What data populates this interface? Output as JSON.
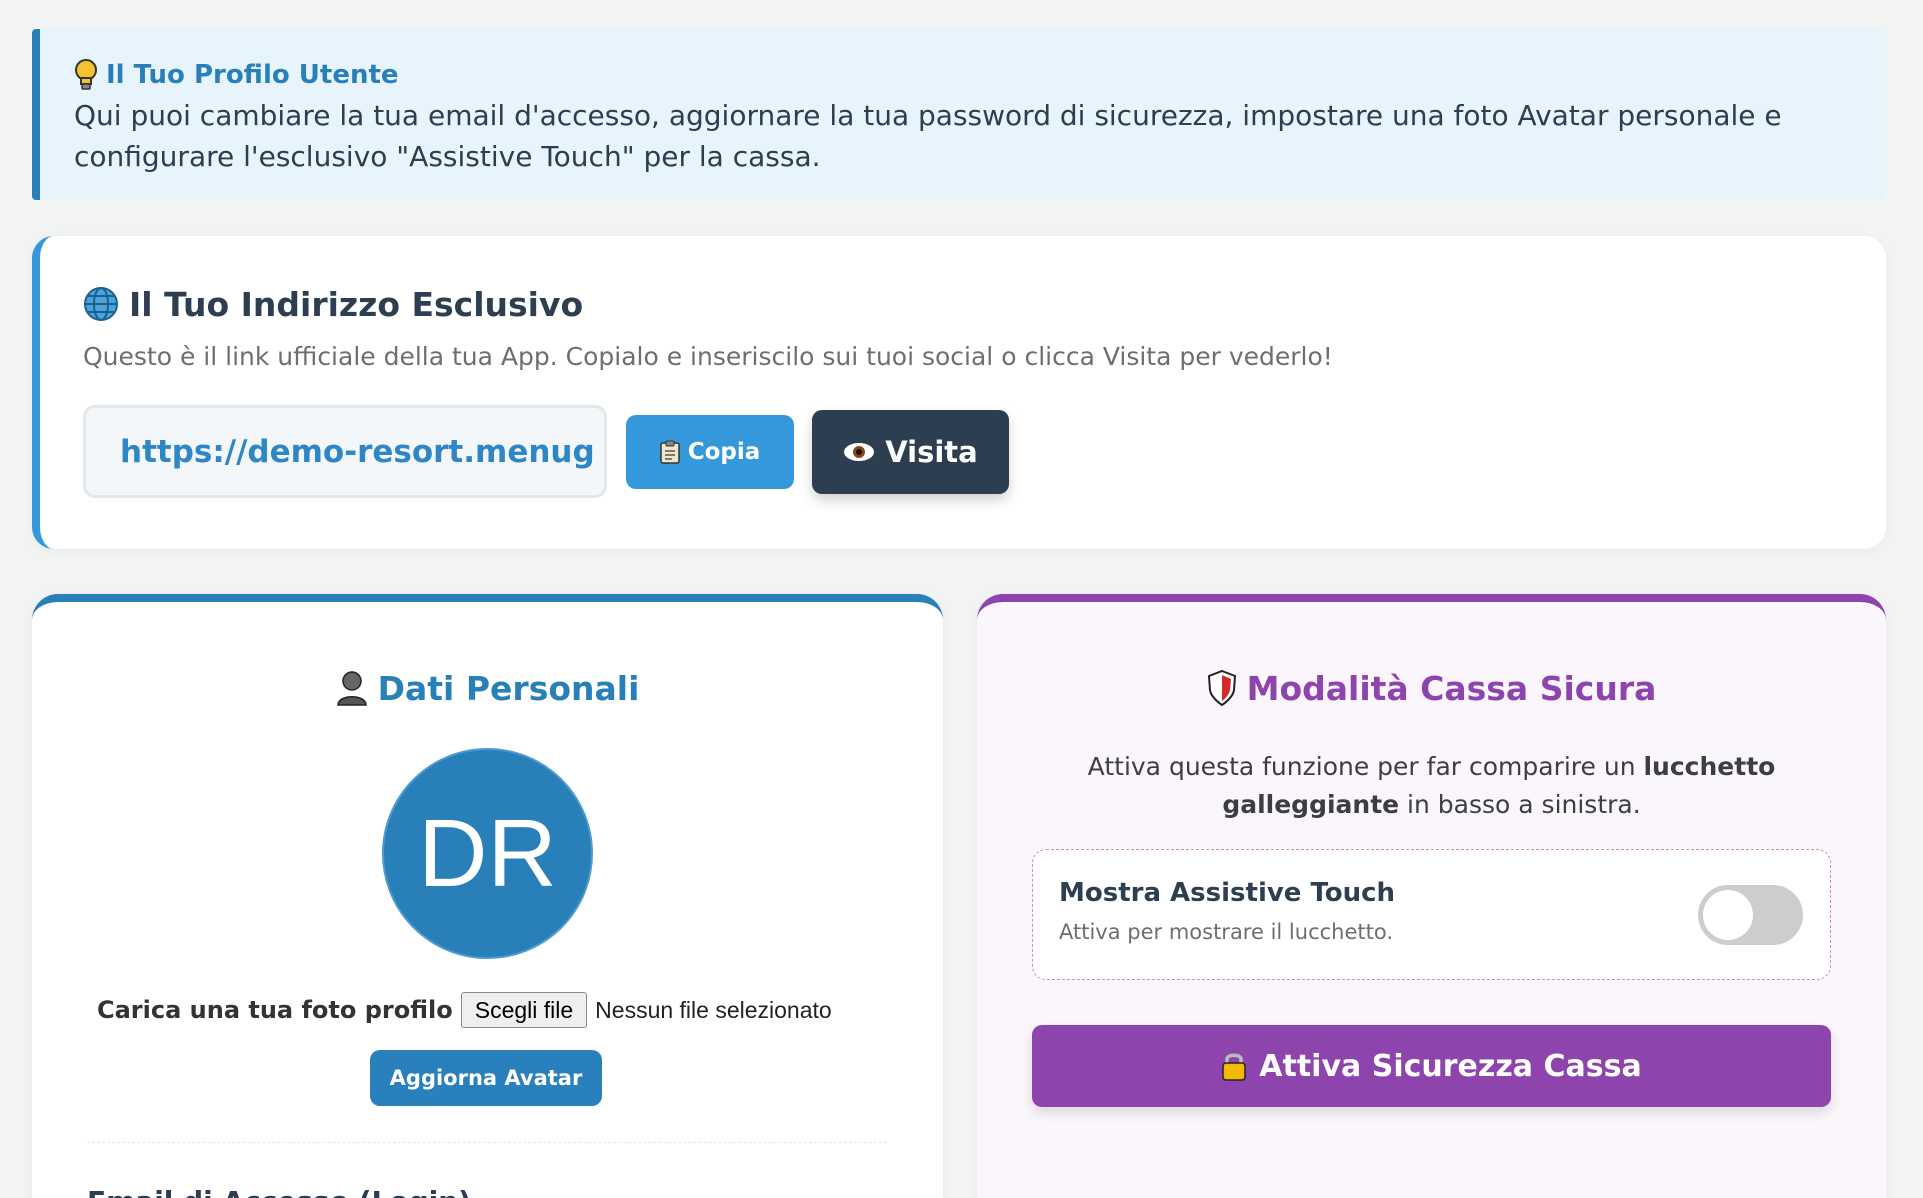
{
  "info_banner": {
    "title": "Il Tuo Profilo Utente",
    "text": "Qui puoi cambiare la tua email d'accesso, aggiornare la tua password di sicurezza, impostare una foto Avatar personale e configurare l'esclusivo \"Assistive Touch\" per la cassa.",
    "icon": "lightbulb-icon"
  },
  "address": {
    "title": "Il Tuo Indirizzo Esclusivo",
    "description": "Questo è il link ufficiale della tua App. Copialo e inseriscilo sui tuoi social o clicca Visita per vederlo!",
    "url": "https://demo-resort.menug",
    "copy_label": "Copia",
    "visit_label": "Visita",
    "icon": "globe-icon"
  },
  "personal": {
    "title": "Dati Personali",
    "avatar_initials": "DR",
    "upload_label": "Carica una tua foto profilo",
    "file_button": "Scegli file",
    "file_status": "Nessun file selezionato",
    "update_avatar_label": "Aggiorna Avatar",
    "next_section_title": "Email di Accesso (Login)",
    "icon": "person-icon"
  },
  "secure": {
    "title": "Modalità Cassa Sicura",
    "desc_part1": "Attiva questa funzione per far comparire un ",
    "desc_bold": "lucchetto galleggiante",
    "desc_part2": " in basso a sinistra.",
    "toggle_title": "Mostra Assistive Touch",
    "toggle_subtitle": "Attiva per mostrare il lucchetto.",
    "toggle_on": false,
    "activate_label": "Attiva Sicurezza Cassa",
    "icon": "shield-icon"
  },
  "colors": {
    "primary_blue": "#2980b9",
    "accent_purple": "#8e44ad",
    "dark": "#2c3e50"
  }
}
